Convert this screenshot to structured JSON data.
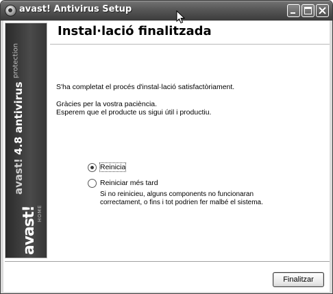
{
  "window": {
    "title": "avast! Antivirus Setup"
  },
  "sidebar": {
    "product_brand": "avast!",
    "product_version": "4.8",
    "product_name": "antivirus",
    "product_tagline": "protection",
    "logo_text": "avast!",
    "logo_subtext": "HOME"
  },
  "page": {
    "heading": "Instal·lació finalitzada",
    "message_completed": "S'ha completat el procés d'instal·lació satisfactòriament.",
    "message_thanks": "Gràcies per la vostra paciència.",
    "message_hope": "Esperem que el producte us sigui útil i productiu."
  },
  "options": {
    "restart_label": "Reinicia",
    "restart_selected": true,
    "restart_later_label": "Reiniciar més tard",
    "restart_later_selected": false,
    "warning_line1": "Si no reinicieu, alguns components no funcionaran",
    "warning_line2": "correctament, o fins i tot podrien fer malbé el sistema."
  },
  "footer": {
    "finish_label": "Finalitzar"
  },
  "colors": {
    "titlebar": "#4a4a4a",
    "sidebar": "#3a3a3a",
    "content_bg": "#ffffff",
    "frame_bg": "#dcdcdc"
  },
  "icons": {
    "app": "avast-logo-icon",
    "minimize": "minimize-icon",
    "maximize": "maximize-icon",
    "close": "close-icon",
    "cursor": "mouse-pointer-icon"
  }
}
